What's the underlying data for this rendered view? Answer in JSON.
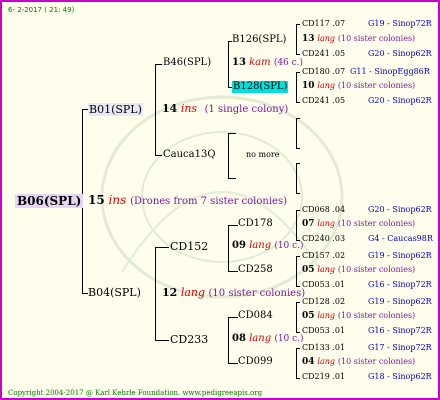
{
  "header": {
    "date": "6- 2-2017 ( 21: 49)"
  },
  "copyright": "Copyright 2004-2017 @ Karl Kehrle Foundation.   www.pedigreeapis.org",
  "root": {
    "label": "B06(SPL)",
    "count": "15",
    "kind": "ins",
    "note": "(Drones from 7 sister colonies)"
  },
  "sire": {
    "label": "B01(SPL)",
    "count": "14",
    "kind": "ins",
    "note": "(1 single colony)"
  },
  "dam": {
    "label": "B04(SPL)",
    "count": "12",
    "kind": "lang",
    "note": "(10 sister colonies)"
  },
  "b46": {
    "label": "B46(SPL)"
  },
  "cauca": {
    "label": "Cauca13Q",
    "unknown": "no more"
  },
  "b126": {
    "label": "B126(SPL)",
    "count": "13",
    "kind": "kam",
    "note": "(46 c.)"
  },
  "b128": {
    "label": "B128(SPL)",
    "count": "10",
    "kind": "lang",
    "note": "(10 sister colonies)"
  },
  "cd152": {
    "label": "CD152",
    "count": "09",
    "kind": "lang",
    "note": "(10 c.)"
  },
  "cd233": {
    "label": "CD233",
    "count": "08",
    "kind": "lang",
    "note": "(10 c.)"
  },
  "cd178": {
    "label": "CD178",
    "count": "07",
    "kind": "lang",
    "note": "(10 sister colonies)"
  },
  "cd258": {
    "label": "CD258",
    "count": "05",
    "kind": "lang",
    "note": "(10 sister colonies)"
  },
  "cd084": {
    "label": "CD084",
    "count": "05",
    "kind": "lang",
    "note": "(10 sister colonies)"
  },
  "cd099": {
    "label": "CD099",
    "count": "04",
    "kind": "lang",
    "note": "(10 sister colonies)"
  },
  "g": {
    "r1": {
      "id": "CD117",
      "yr": ".07",
      "ref": "G19 - Sinop72R"
    },
    "r2": {
      "id": "CD241",
      "yr": ".05",
      "ref": "G20 - Sinop62R"
    },
    "r3": {
      "id": "CD180",
      "yr": ".07",
      "ref": "G11 - SinopEgg86R"
    },
    "r4": {
      "id": "CD241",
      "yr": ".05",
      "ref": "G20 - Sinop62R"
    },
    "r5": {
      "id": "CD068",
      "yr": ".04",
      "ref": "G20 - Sinop62R"
    },
    "r6": {
      "id": "CD240",
      "yr": ".03",
      "ref": "G4 - Caucas98R"
    },
    "r7": {
      "id": "CD157",
      "yr": ".02",
      "ref": "G19 - Sinop62R"
    },
    "r8": {
      "id": "CD053",
      "yr": ".01",
      "ref": "G16 - Sinop72R"
    },
    "r9": {
      "id": "CD128",
      "yr": ".02",
      "ref": "G19 - Sinop62R"
    },
    "r10": {
      "id": "CD053",
      "yr": ".01",
      "ref": "G16 - Sinop72R"
    },
    "r11": {
      "id": "CD133",
      "yr": ".01",
      "ref": "G17 - Sinop72R"
    },
    "r12": {
      "id": "CD219",
      "yr": ".01",
      "ref": "G18 - Sinop62R"
    }
  },
  "colors": {
    "frame": "#cc00cc",
    "background": "#fffdec",
    "kind": "#dd0000",
    "note": "#7a1aa0",
    "ref": "#0000cc",
    "highlight": "#00e0e0",
    "rootHighlight": "#e8d4f4"
  }
}
